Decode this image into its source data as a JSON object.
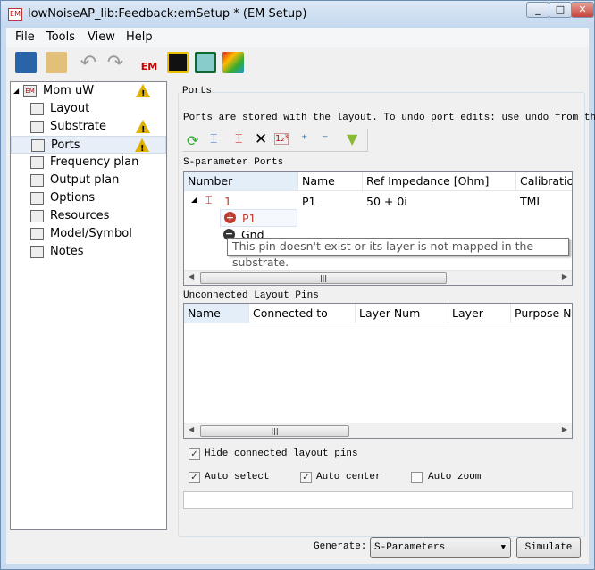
{
  "window": {
    "title": "lowNoiseAP_lib:Feedback:emSetup * (EM Setup)",
    "icon_label": "EM",
    "controls": [
      "minimize",
      "maximize",
      "close"
    ]
  },
  "menu": [
    "File",
    "Tools",
    "View",
    "Help"
  ],
  "toolbar": [
    "save-icon",
    "open-icon",
    "undo-icon",
    "redo-icon",
    "em-icon",
    "layout-icon",
    "3d-view-icon",
    "visualization-icon"
  ],
  "toolbar_em_label": "EM",
  "tree": {
    "root": {
      "label": "Mom uW",
      "icon": "EM",
      "warning": true
    },
    "items": [
      {
        "label": "Layout",
        "icon": "layout-icon",
        "warning": false
      },
      {
        "label": "Substrate",
        "icon": "substrate-icon",
        "warning": true
      },
      {
        "label": "Ports",
        "icon": "port-icon",
        "warning": true,
        "selected": true
      },
      {
        "label": "Frequency plan",
        "icon": "GHz",
        "warning": false
      },
      {
        "label": "Output plan",
        "icon": "output-icon",
        "warning": false
      },
      {
        "label": "Options",
        "icon": "options-icon",
        "warning": false
      },
      {
        "label": "Resources",
        "icon": "resources-icon",
        "warning": false
      },
      {
        "label": "Model/Symbol",
        "icon": "EM",
        "warning": false
      },
      {
        "label": "Notes",
        "icon": "notes-icon",
        "warning": false
      }
    ]
  },
  "ports": {
    "group_title": "Ports",
    "info": "Ports are stored with the layout. To undo port edits: use undo from the l",
    "tools": [
      "refresh-icon",
      "add-port-auto-icon",
      "add-port-icon",
      "delete-icon",
      "renumber-icon",
      "add-pin-icon",
      "remove-pin-icon",
      "filter-icon"
    ],
    "sparam_title": "S-parameter Ports",
    "sparam_columns": [
      "Number",
      "Name",
      "Ref Impedance [Ohm]",
      "Calibration"
    ],
    "sparam_rows": [
      {
        "number": "1",
        "name": "P1",
        "impedance": "50 + 0i",
        "calibration": "TML",
        "children": [
          {
            "sign": "+",
            "label": "P1"
          },
          {
            "sign": "-",
            "label": "Gnd"
          }
        ]
      }
    ],
    "tooltip": "This pin doesn't exist or its layer is not mapped in the substrate.",
    "unconnected_title": "Unconnected Layout Pins",
    "unconnected_columns": [
      "Name",
      "Connected to",
      "Layer Num",
      "Layer",
      "Purpose Nu"
    ],
    "hide_connected": {
      "label": "Hide connected layout pins",
      "checked": true
    },
    "auto_select": {
      "label": "Auto select",
      "checked": true
    },
    "auto_center": {
      "label": "Auto center",
      "checked": true
    },
    "auto_zoom": {
      "label": "Auto zoom",
      "checked": false
    },
    "message": ""
  },
  "footer": {
    "generate_label": "Generate:",
    "generate_value": "S-Parameters",
    "simulate": "Simulate"
  },
  "colors": {
    "accent_red": "#c0392b",
    "warning": "#e0b000",
    "selection": "#e8eef7"
  }
}
